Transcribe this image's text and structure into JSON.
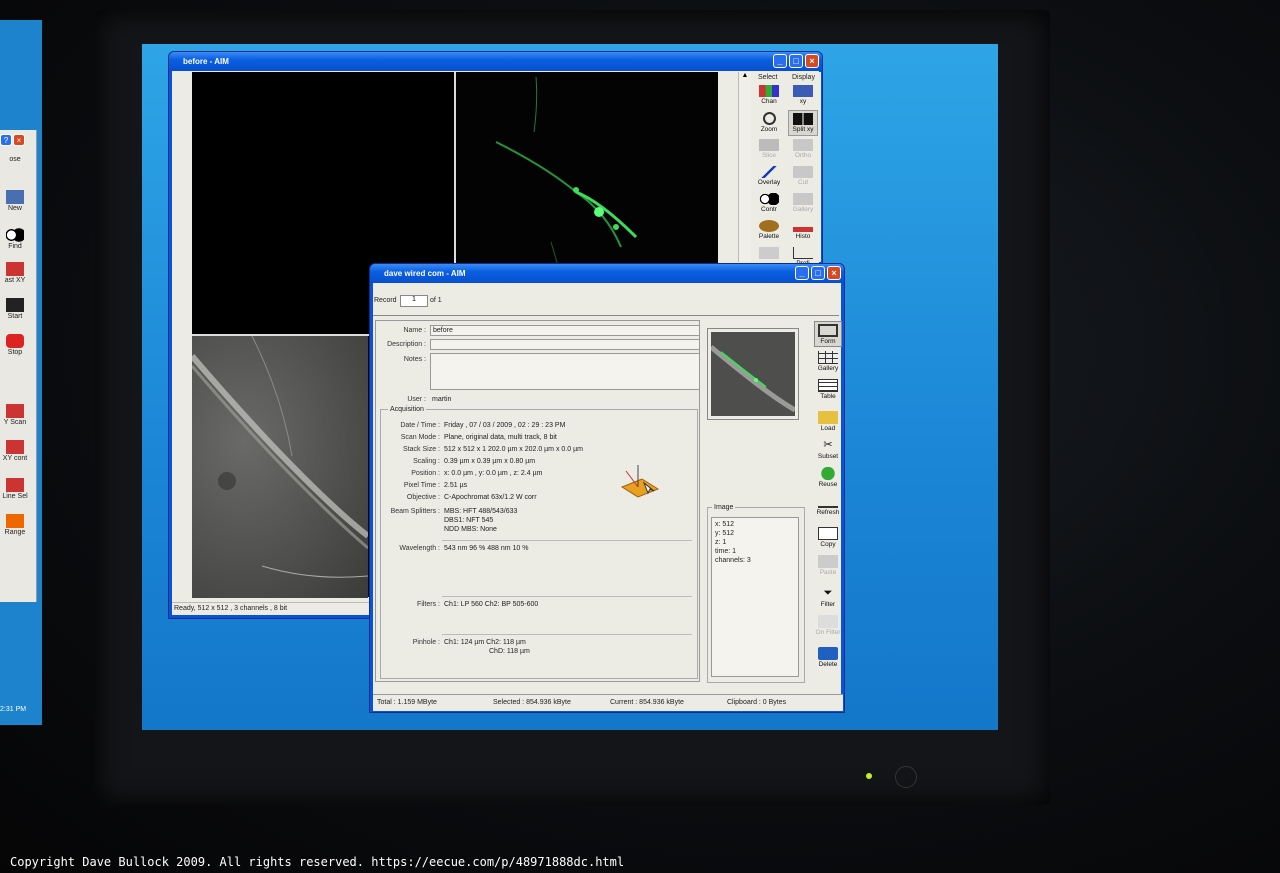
{
  "copyright": "Copyright Dave Bullock 2009. All rights reserved. https://eecue.com/p/48971888dc.html",
  "left_panel": {
    "items": [
      {
        "label": "ose"
      },
      {
        "label": "New"
      },
      {
        "label": "Find"
      },
      {
        "label": "ast XY"
      },
      {
        "label": "Start"
      },
      {
        "label": "Stop"
      },
      {
        "label": "Y Scan"
      },
      {
        "label": "XY cont"
      },
      {
        "label": "Line Sel"
      },
      {
        "label": "Range"
      }
    ],
    "clock": "2:31 PM"
  },
  "before_window": {
    "title": "before - AIM",
    "status": "Ready, 512 x 512 , 3 channels , 8 bit",
    "toolbar": {
      "select_header": "Select",
      "display_header": "Display",
      "left": [
        {
          "label": "Chan",
          "icon": "channels-icon"
        },
        {
          "label": "Zoom",
          "icon": "zoom-icon"
        },
        {
          "label": "Slice",
          "icon": "slice-icon",
          "disabled": true
        },
        {
          "label": "Overlay",
          "icon": "overlay-icon"
        },
        {
          "label": "Contr",
          "icon": "contrast-icon"
        },
        {
          "label": "Palette",
          "icon": "palette-icon"
        }
      ],
      "right": [
        {
          "label": "xy",
          "icon": "xy-icon"
        },
        {
          "label": "Split xy",
          "icon": "split-xy-icon"
        },
        {
          "label": "Ortho",
          "icon": "ortho-icon",
          "disabled": true
        },
        {
          "label": "Cut",
          "icon": "cut-icon",
          "disabled": true
        },
        {
          "label": "Gallery",
          "icon": "gallery-icon",
          "disabled": true
        },
        {
          "label": "Histo",
          "icon": "histogram-icon"
        },
        {
          "label": "Profi",
          "icon": "profile-icon"
        }
      ]
    }
  },
  "dave_window": {
    "title": "dave wired com - AIM",
    "record_label": "Record",
    "record_value": "1",
    "record_of": "of 1",
    "fields": {
      "name_label": "Name :",
      "name_value": "before",
      "description_label": "Description :",
      "notes_label": "Notes :",
      "user_label": "User :",
      "user_value": "martin"
    },
    "acquisition": {
      "section_label": "Acquisition",
      "rows": [
        {
          "label": "Date / Time :",
          "value": "Friday , 07 / 03 / 2009 , 02 : 29 : 23  PM"
        },
        {
          "label": "Scan Mode :",
          "value": "Plane, original data, multi track, 8 bit"
        },
        {
          "label": "Stack Size :",
          "value": "512 x 512 x 1     202.0 µm x 202.0 µm x 0.0 µm"
        },
        {
          "label": "Scaling :",
          "value": "0.39 µm x 0.39 µm x 0.80 µm"
        },
        {
          "label": "Position :",
          "value": "x: 0.0 µm , y: 0.0 µm , z: 2.4 µm"
        },
        {
          "label": "Pixel Time :",
          "value": "2.51 µs"
        },
        {
          "label": "Objective :",
          "value": "C-Apochromat 63x/1.2 W corr"
        }
      ],
      "beam_label": "Beam Splitters :",
      "beam_lines": [
        "MBS: HFT 488/543/633",
        "DBS1: NFT 545",
        "NDD MBS: None"
      ],
      "wavelength_label": "Wavelength :",
      "wavelength_value": "543 nm 96 %    488 nm 10 %",
      "filters_label": "Filters :",
      "filters_value": "Ch1: LP 560    Ch2: BP 505-600",
      "pinhole_label": "Pinhole :",
      "pinhole_line1": "Ch1: 124 µm     Ch2: 118 µm",
      "pinhole_line2": "ChD: 118 µm"
    },
    "image_section": {
      "label": "Image",
      "lines": [
        "x: 512",
        "y: 512",
        "z: 1",
        "time: 1",
        "channels: 3"
      ]
    },
    "right_buttons": [
      {
        "label": "Form",
        "icon": "form-icon"
      },
      {
        "label": "Gallery",
        "icon": "gallery-grid-icon"
      },
      {
        "label": "Table",
        "icon": "table-icon"
      },
      {
        "label": "Load",
        "icon": "folder-open-icon"
      },
      {
        "label": "Subset",
        "icon": "scissors-icon"
      },
      {
        "label": "Reuse",
        "icon": "reuse-icon"
      },
      {
        "label": "Refresh",
        "icon": "refresh-icon"
      },
      {
        "label": "Copy",
        "icon": "copy-icon"
      },
      {
        "label": "Paste",
        "icon": "paste-icon",
        "disabled": true
      },
      {
        "label": "Filter",
        "icon": "filter-icon"
      },
      {
        "label": "On Filter",
        "icon": "filter-on-icon",
        "disabled": true
      },
      {
        "label": "Delete",
        "icon": "delete-icon"
      }
    ],
    "status": {
      "total": "Total :  1.159 MByte",
      "selected": "Selected :  854.936 kByte",
      "current": "Current :  854.936 kByte",
      "clipboard": "Clipboard :  0 Bytes"
    }
  },
  "colors": {
    "desktop": "#1b86d6",
    "titlebar": "#0a5fe0",
    "window_face": "#ecebe4",
    "fluorescence": "#3ddc5a"
  }
}
